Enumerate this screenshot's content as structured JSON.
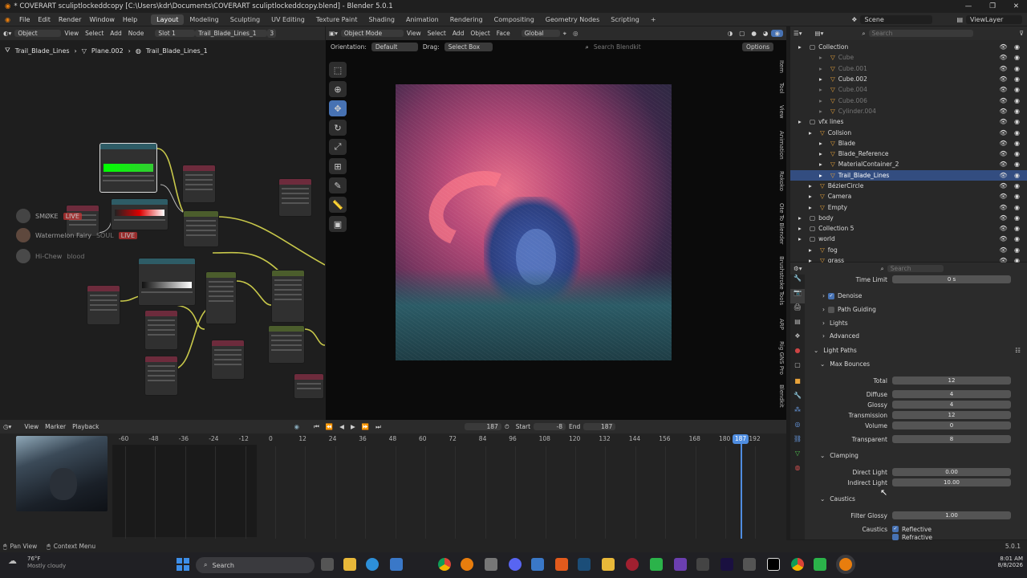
{
  "window": {
    "title": "* COVERART sculiptlockeddcopy [C:\\Users\\kdr\\Documents\\COVERART sculiptlockeddcopy.blend] - Blender 5.0.1"
  },
  "menubar": {
    "items": [
      "File",
      "Edit",
      "Render",
      "Window",
      "Help"
    ],
    "workspaces": [
      "Layout",
      "Modeling",
      "Sculpting",
      "UV Editing",
      "Texture Paint",
      "Shading",
      "Animation",
      "Rendering",
      "Compositing",
      "Geometry Nodes",
      "Scripting"
    ],
    "scene": "Scene",
    "view_layer": "ViewLayer"
  },
  "node_editor": {
    "header": [
      "Object",
      "View",
      "Select",
      "Add",
      "Node"
    ],
    "slot": "Slot 1",
    "material": "Trail_Blade_Lines_1",
    "user_count": "3",
    "breadcrumb": [
      "Trail_Blade_Lines",
      "Plane.002",
      "Trail_Blade_Lines_1"
    ]
  },
  "overlay_chat": [
    {
      "name": "SMØKE",
      "tag": "LIVE"
    },
    {
      "name": "Watermelon Fairy",
      "tag": "SOUL",
      "tag2": "LIVE"
    },
    {
      "name": "Hi-Chew",
      "tag": "blood"
    }
  ],
  "viewport": {
    "mode": "Object Mode",
    "menu": [
      "View",
      "Select",
      "Add",
      "Object",
      "Face"
    ],
    "transform": "Global",
    "orientation_label": "Orientation:",
    "orientation": "Default",
    "drag_label": "Drag:",
    "drag": "Select Box",
    "search_placeholder": "Search Blendkit",
    "options": "Options",
    "side_tabs": [
      "Item",
      "Tool",
      "View",
      "Animation",
      "Rokoko",
      "Ote To Blender",
      "Brushstroke Tools",
      "ARP",
      "Rig GNS Pro",
      "Blendkit"
    ]
  },
  "outliner": {
    "search_placeholder": "Search",
    "rows": [
      {
        "name": "Collection",
        "indent": 0,
        "dim": false,
        "sel": false
      },
      {
        "name": "Cube",
        "indent": 2,
        "dim": true,
        "sel": false
      },
      {
        "name": "Cube.001",
        "indent": 2,
        "dim": true,
        "sel": false
      },
      {
        "name": "Cube.002",
        "indent": 2,
        "dim": false,
        "sel": false
      },
      {
        "name": "Cube.004",
        "indent": 2,
        "dim": true,
        "sel": false
      },
      {
        "name": "Cube.006",
        "indent": 2,
        "dim": true,
        "sel": false
      },
      {
        "name": "Cylinder.004",
        "indent": 2,
        "dim": true,
        "sel": false
      },
      {
        "name": "vfx lines",
        "indent": 0,
        "dim": false,
        "sel": false
      },
      {
        "name": "Collsion",
        "indent": 1,
        "dim": false,
        "sel": false
      },
      {
        "name": "Blade",
        "indent": 2,
        "dim": false,
        "sel": false
      },
      {
        "name": "Blade_Reference",
        "indent": 2,
        "dim": false,
        "sel": false
      },
      {
        "name": "MaterialContainer_2",
        "indent": 2,
        "dim": false,
        "sel": false
      },
      {
        "name": "Trail_Blade_Lines",
        "indent": 2,
        "dim": false,
        "sel": true
      },
      {
        "name": "BézierCircle",
        "indent": 1,
        "dim": false,
        "sel": false
      },
      {
        "name": "Camera",
        "indent": 1,
        "dim": false,
        "sel": false
      },
      {
        "name": "Empty",
        "indent": 1,
        "dim": false,
        "sel": false
      },
      {
        "name": "body",
        "indent": 0,
        "dim": false,
        "sel": false
      },
      {
        "name": "Collection 5",
        "indent": 0,
        "dim": false,
        "sel": false
      },
      {
        "name": "world",
        "indent": 0,
        "dim": false,
        "sel": false
      },
      {
        "name": "fog",
        "indent": 1,
        "dim": false,
        "sel": false
      },
      {
        "name": "grass",
        "indent": 1,
        "dim": false,
        "sel": false
      }
    ]
  },
  "properties": {
    "search_placeholder": "Search",
    "time_limit": {
      "label": "Time Limit",
      "value": "0 s"
    },
    "denoise": "Denoise",
    "path_guiding": "Path Guiding",
    "lights": "Lights",
    "advanced": "Advanced",
    "light_paths": "Light Paths",
    "max_bounces": "Max Bounces",
    "bounces": [
      {
        "label": "Total",
        "value": "12"
      },
      {
        "label": "Diffuse",
        "value": "4"
      },
      {
        "label": "Glossy",
        "value": "4"
      },
      {
        "label": "Transmission",
        "value": "12"
      },
      {
        "label": "Volume",
        "value": "0"
      },
      {
        "label": "Transparent",
        "value": "8"
      }
    ],
    "clamping": "Clamping",
    "clamp": [
      {
        "label": "Direct Light",
        "value": "0.00"
      },
      {
        "label": "Indirect Light",
        "value": "10.00"
      }
    ],
    "caustics": "Caustics",
    "filter_glossy": {
      "label": "Filter Glossy",
      "value": "1.00"
    },
    "caustics_label": "Caustics",
    "reflective": "Reflective",
    "refractive": "Refractive"
  },
  "timeline": {
    "menu": [
      "View",
      "Marker",
      "Playback"
    ],
    "current_frame": "187",
    "start_label": "Start",
    "start": "-8",
    "end_label": "End",
    "end": "187",
    "ticks": [
      "-60",
      "-48",
      "-36",
      "-24",
      "-12",
      "0",
      "12",
      "24",
      "36",
      "48",
      "60",
      "72",
      "84",
      "96",
      "108",
      "120",
      "132",
      "144",
      "156",
      "168",
      "180",
      "192"
    ],
    "playhead": "187"
  },
  "statusbar": {
    "left1": "Pan View",
    "left2": "Context Menu",
    "version": "5.0.1"
  },
  "taskbar": {
    "weather_temp": "76°F",
    "weather_text": "Mostly cloudy",
    "search": "Search",
    "time": "8:01 AM",
    "date": "8/8/2026"
  }
}
